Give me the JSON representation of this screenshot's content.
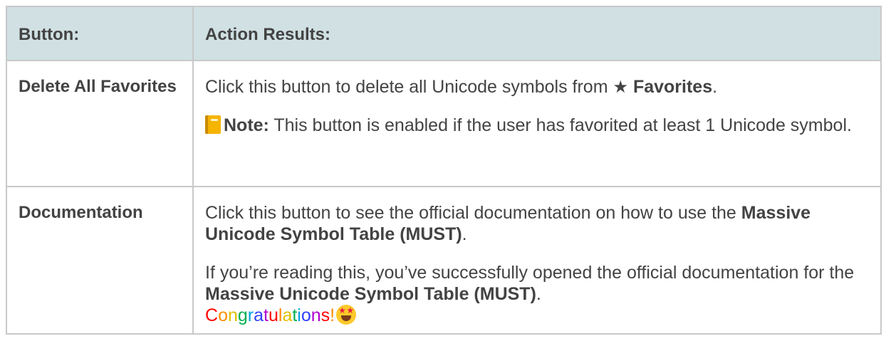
{
  "table": {
    "headers": {
      "button": "Button:",
      "results": "Action Results:"
    },
    "rows": [
      {
        "button": "Delete All Favorites",
        "description": {
          "p1_text": "Click this button to delete all Unicode symbols from ",
          "p1_star": "★",
          "p1_bold": "Favorites",
          "p1_end": ".",
          "note_label": "Note:",
          "note_text": " This button is enabled if the user has favorited at least 1 Unicode symbol.",
          "note_icon": "notebook-icon"
        }
      },
      {
        "button": "Documentation",
        "description": {
          "p1_text": "Click this button to see the official documentation on how to use the ",
          "p1_bold": "Massive Unicode Symbol Table (MUST)",
          "p1_end": ".",
          "p2_text": "If you’re reading this, you’ve successfully opened the official documentation for the ",
          "p2_bold": "Massive Unicode Symbol Table (MUST)",
          "p2_end": ".",
          "congrats": "Congratulations!",
          "congrats_icon": "star-struck-emoji-icon"
        }
      }
    ]
  },
  "colors": {
    "header_bg": "#d0e0e3",
    "text": "#434343",
    "border": "#c9c9c9"
  }
}
